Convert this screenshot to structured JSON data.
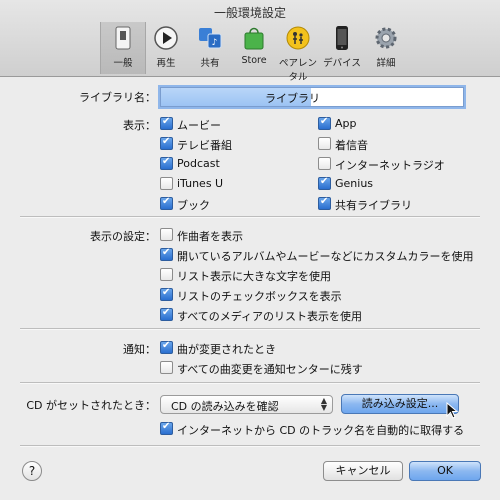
{
  "window": {
    "title": "一般環境設定"
  },
  "toolbar": {
    "items": [
      {
        "label": "一般",
        "icon": "general-switch-icon"
      },
      {
        "label": "再生",
        "icon": "play-icon"
      },
      {
        "label": "共有",
        "icon": "sharing-icon"
      },
      {
        "label": "Store",
        "icon": "store-bag-icon"
      },
      {
        "label": "ペアレンタル",
        "icon": "parental-icon"
      },
      {
        "label": "デバイス",
        "icon": "iphone-icon"
      },
      {
        "label": "詳細",
        "icon": "gear-icon"
      }
    ],
    "selected": "一般"
  },
  "library": {
    "label": "ライブラリ名：",
    "value_suffix": "ライブラリ"
  },
  "display": {
    "label": "表示：",
    "left": [
      {
        "label": "ムービー",
        "checked": true
      },
      {
        "label": "テレビ番組",
        "checked": true
      },
      {
        "label": "Podcast",
        "checked": true
      },
      {
        "label": "iTunes U",
        "checked": false
      },
      {
        "label": "ブック",
        "checked": true
      }
    ],
    "right": [
      {
        "label": "App",
        "checked": true
      },
      {
        "label": "着信音",
        "checked": false
      },
      {
        "label": "インターネットラジオ",
        "checked": false
      },
      {
        "label": "Genius",
        "checked": true
      },
      {
        "label": "共有ライブラリ",
        "checked": true
      }
    ]
  },
  "view_settings": {
    "label": "表示の設定：",
    "options": [
      {
        "label": "作曲者を表示",
        "checked": false
      },
      {
        "label": "開いているアルバムやムービーなどにカスタムカラーを使用",
        "checked": true
      },
      {
        "label": "リスト表示に大きな文字を使用",
        "checked": false
      },
      {
        "label": "リストのチェックボックスを表示",
        "checked": true
      },
      {
        "label": "すべてのメディアのリスト表示を使用",
        "checked": true
      }
    ]
  },
  "notifications": {
    "label": "通知：",
    "options": [
      {
        "label": "曲が変更されたとき",
        "checked": true
      },
      {
        "label": "すべての曲変更を通知センターに残す",
        "checked": false
      }
    ]
  },
  "cd": {
    "label": "CD がセットされたとき：",
    "select_value": "CD の読み込みを確認",
    "import_button": "読み込み設定...",
    "auto_fetch": {
      "label": "インターネットから CD のトラック名を自動的に取得する",
      "checked": true
    }
  },
  "footer": {
    "help": "?",
    "cancel": "キャンセル",
    "ok": "OK"
  }
}
